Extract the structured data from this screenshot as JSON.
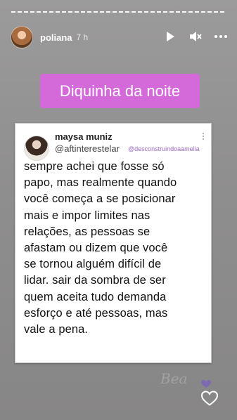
{
  "header": {
    "username": "poliana",
    "time": "7 h"
  },
  "story": {
    "title": "Diquinha da noite"
  },
  "tweet": {
    "name": "maysa muniz",
    "handle": "@aftinterestelar",
    "credit": "@desconstruindoaamelia",
    "text": "sempre achei que fosse só\npapo, mas realmente quando\nvocê começa a se posicionar\nmais e impor limites nas\nrelações, as pessoas se\nafastam ou dizem que você\nse tornou alguém difícil de\nlidar. sair da sombra de ser\nquem aceita tudo demanda\nesforço e até pessoas, mas\nvale a pena."
  },
  "icons": {
    "play": "play-icon",
    "mute": "mute-icon",
    "more": "more-icon",
    "like": "heart-icon"
  },
  "colors": {
    "pill": "#d46ad9",
    "credit": "#9a66c2",
    "background": "#919090"
  }
}
